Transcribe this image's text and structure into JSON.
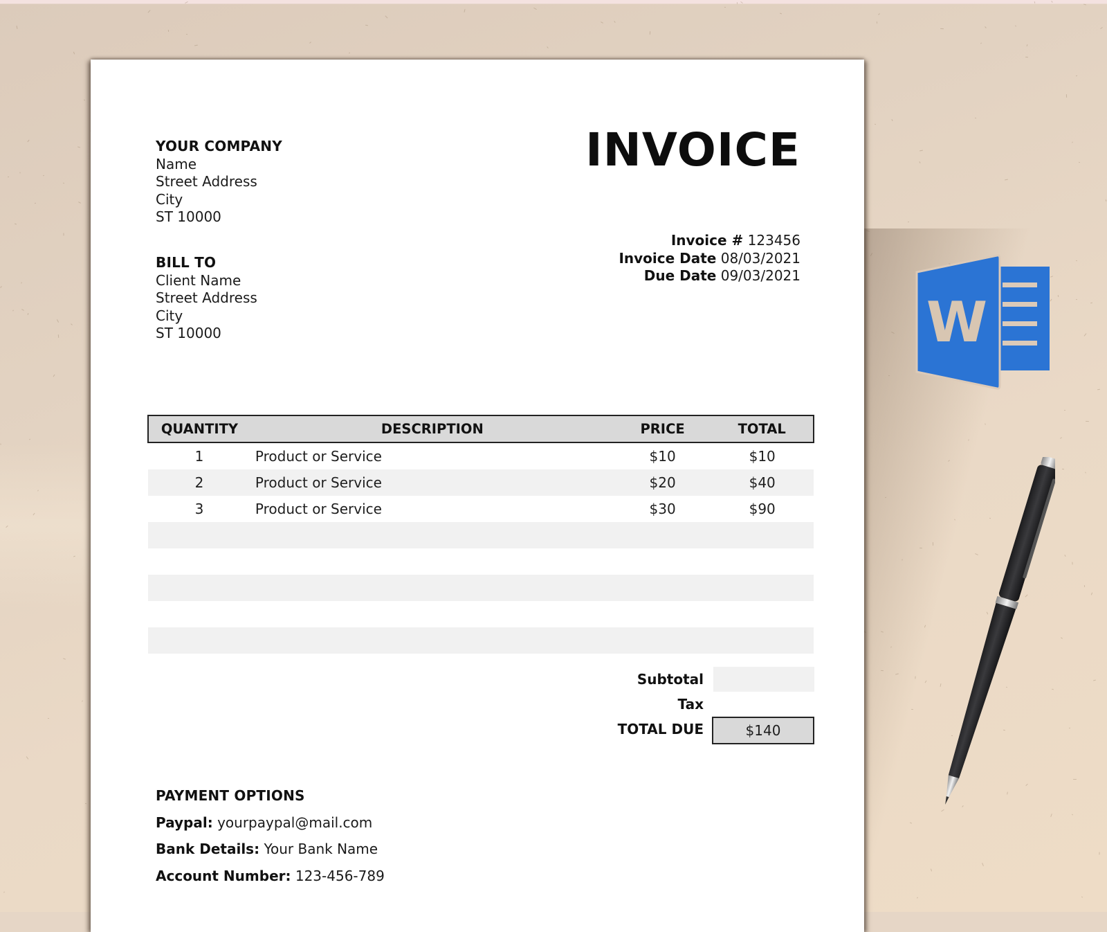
{
  "invoice": {
    "title": "INVOICE",
    "from": {
      "heading": "YOUR COMPANY",
      "lines": [
        "Name",
        "Street Address",
        "City",
        "ST 10000"
      ]
    },
    "bill_to": {
      "heading": "BILL TO",
      "lines": [
        "Client Name",
        "Street Address",
        "City",
        "ST 10000"
      ]
    },
    "meta": {
      "number_label": "Invoice #",
      "number": "123456",
      "date_label": "Invoice Date",
      "date": "08/03/2021",
      "due_label": "Due Date",
      "due": "09/03/2021"
    },
    "table": {
      "headers": [
        "QUANTITY",
        "DESCRIPTION",
        "PRICE",
        "TOTAL"
      ],
      "rows": [
        {
          "qty": "1",
          "desc": "Product or Service",
          "price": "$10",
          "total": "$10"
        },
        {
          "qty": "2",
          "desc": "Product or Service",
          "price": "$20",
          "total": "$40"
        },
        {
          "qty": "3",
          "desc": "Product or Service",
          "price": "$30",
          "total": "$90"
        },
        {
          "qty": "",
          "desc": "",
          "price": "",
          "total": ""
        },
        {
          "qty": "",
          "desc": "",
          "price": "",
          "total": ""
        },
        {
          "qty": "",
          "desc": "",
          "price": "",
          "total": ""
        },
        {
          "qty": "",
          "desc": "",
          "price": "",
          "total": ""
        },
        {
          "qty": "",
          "desc": "",
          "price": "",
          "total": ""
        }
      ]
    },
    "totals": {
      "subtotal_label": "Subtotal",
      "subtotal": "",
      "tax_label": "Tax",
      "tax": "",
      "total_due_label": "TOTAL DUE",
      "total_due": "$140"
    },
    "payment": {
      "heading": "PAYMENT OPTIONS",
      "paypal_label": "Paypal:",
      "paypal": "yourpaypal@mail.com",
      "bank_label": "Bank Details:",
      "bank": "Your Bank Name",
      "account_label": "Account Number:",
      "account": "123-456-789"
    }
  },
  "decor": {
    "word_icon": {
      "name": "microsoft-word-icon",
      "letter": "W",
      "color": "#2b74d4"
    },
    "pen": {
      "name": "pen"
    }
  },
  "colors": {
    "background": "#e6d6c6",
    "paper": "#ffffff",
    "table_header": "#d9d9d9",
    "table_stripe": "#f1f1f1",
    "word_blue": "#2b74d4"
  }
}
